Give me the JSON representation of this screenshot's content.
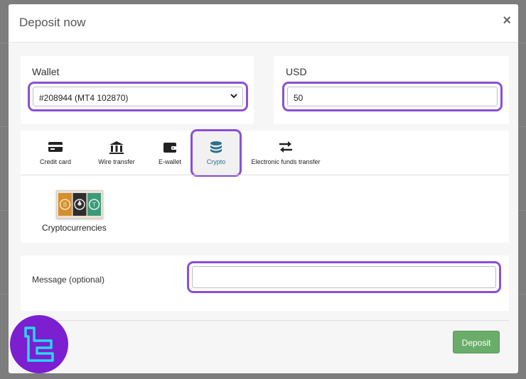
{
  "modal": {
    "title": "Deposit now",
    "close_glyph": "×"
  },
  "wallet": {
    "label": "Wallet",
    "selected": "#208944 (MT4 102870)"
  },
  "amount": {
    "label": "USD",
    "value": "50"
  },
  "methods": {
    "tabs": [
      {
        "label": "Credit card",
        "icon": "credit-card-icon"
      },
      {
        "label": "Wire transfer",
        "icon": "bank-icon"
      },
      {
        "label": "E-wallet",
        "icon": "wallet-icon"
      },
      {
        "label": "Crypto",
        "icon": "coins-icon",
        "active": true
      },
      {
        "label": "Electronic funds transfer",
        "icon": "transfer-arrows-icon"
      }
    ],
    "option": {
      "label": "Cryptocurrencies",
      "icon": "crypto-coins-image"
    }
  },
  "message": {
    "label": "Message (optional)",
    "value": ""
  },
  "actions": {
    "deposit_label": "Deposit"
  },
  "colors": {
    "highlight": "#8a4fd6",
    "deposit_button": "#6aad6a",
    "active_tab_text": "#2b6f8c",
    "logo_bg": "#7b1fd1",
    "logo_mark": "#28d7f0"
  }
}
